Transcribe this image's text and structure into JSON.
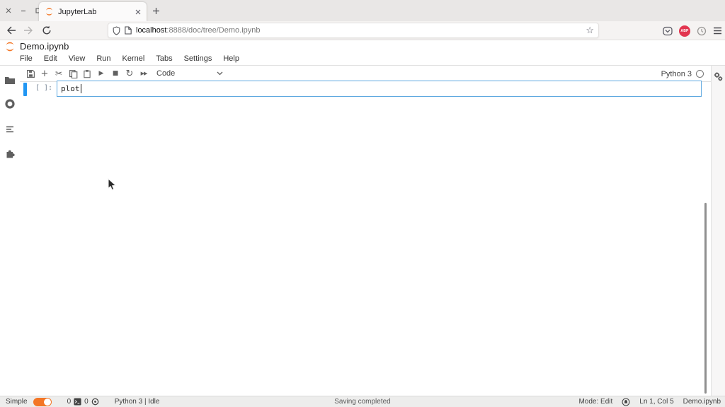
{
  "browser": {
    "tab": {
      "title": "JupyterLab"
    },
    "url": {
      "host": "localhost",
      "rest": ":8888/doc/tree/Demo.ipynb"
    },
    "extensions": {
      "abp_label": "ABP"
    }
  },
  "icons": {
    "plus": "+",
    "scissors": "✂",
    "play": "▶",
    "stop": "■",
    "restart": "↻",
    "fast_forward": "▶▶",
    "star": "☆"
  },
  "jupyterlab": {
    "title": "Demo.ipynb",
    "menus": [
      "File",
      "Edit",
      "View",
      "Run",
      "Kernel",
      "Tabs",
      "Settings",
      "Help"
    ],
    "toolbar": {
      "cell_type": "Code",
      "kernel_name": "Python 3"
    },
    "cell": {
      "prompt": "[ ]:",
      "source": "plot"
    },
    "statusbar": {
      "simple_label": "Simple",
      "terminals_count": "0",
      "kernels_count": "0",
      "kernel_status": "Python 3 | Idle",
      "center_message": "Saving completed",
      "mode": "Mode: Edit",
      "cursor_position": "Ln 1, Col 5",
      "filename": "Demo.ipynb"
    }
  },
  "colors": {
    "jupyter_orange": "#f37726",
    "cell_border_blue": "#5ea8e0",
    "collapser_blue": "#2196f3",
    "toggle_orange": "#f37626",
    "abp_red": "#e2354f"
  }
}
